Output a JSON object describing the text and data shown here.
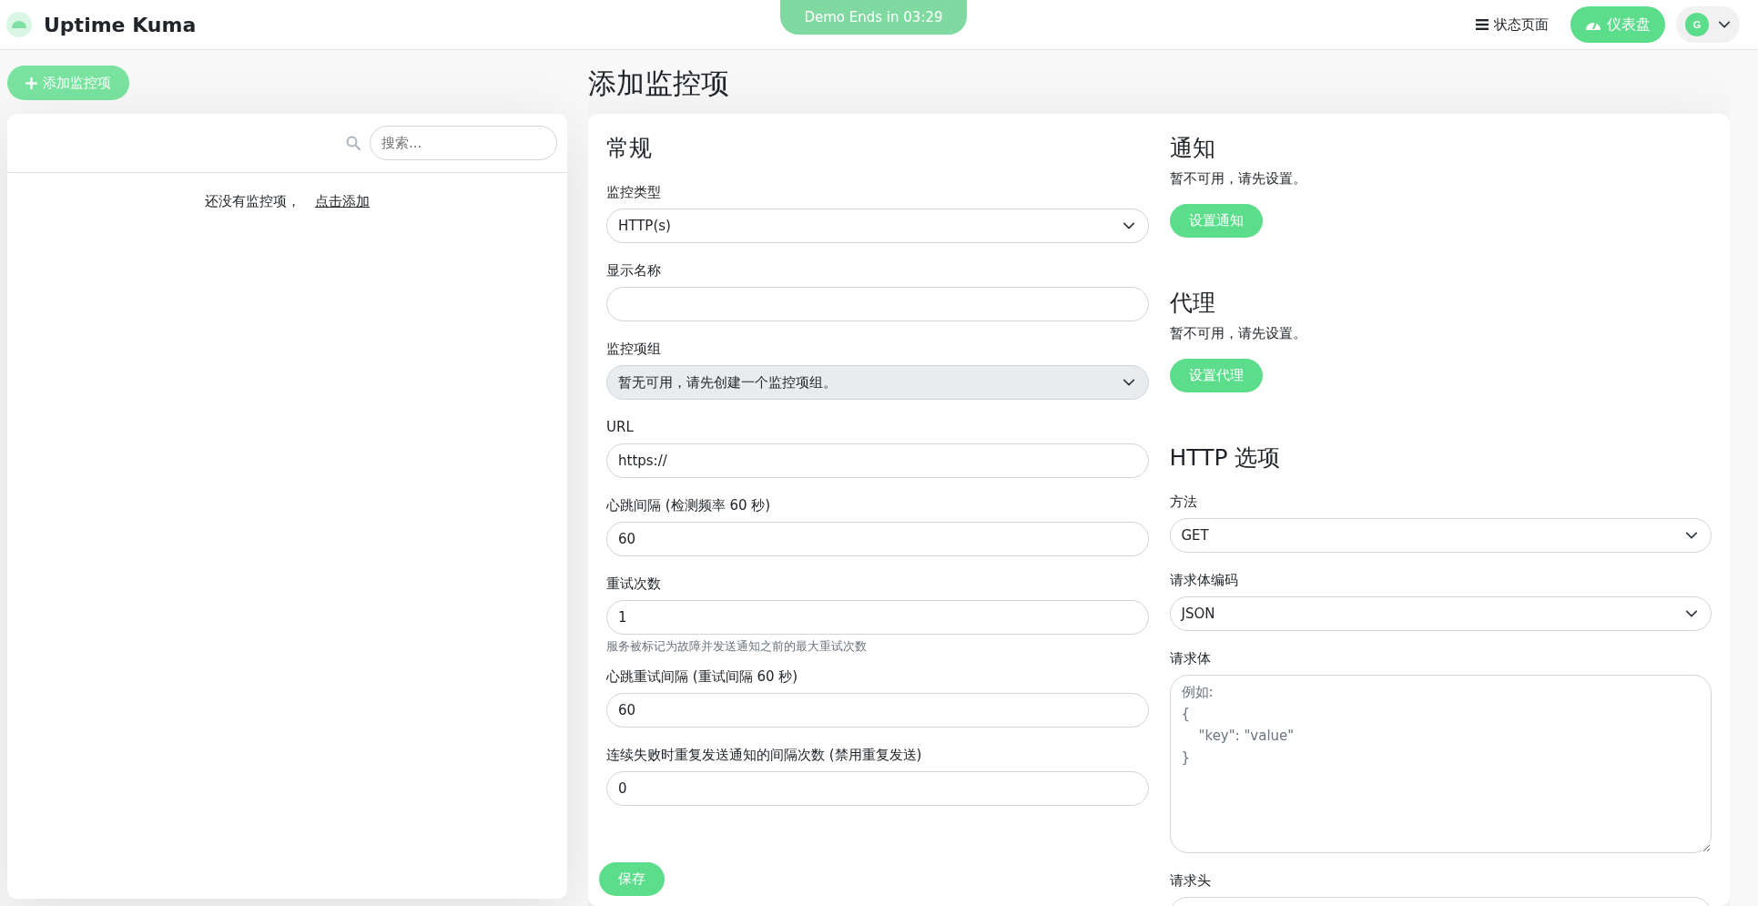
{
  "header": {
    "app_name": "Uptime Kuma",
    "demo_banner": "Demo Ends in 03:29",
    "nav_link": "状态页面",
    "dashboard_button": "仪表盘",
    "avatar_initial": "G"
  },
  "sidebar": {
    "add_button": "添加监控项",
    "search": {
      "placeholder": "搜索..."
    },
    "empty_text": "还没有监控项，",
    "empty_link": "点击添加"
  },
  "page_title": "添加监控项",
  "general": {
    "heading": "常规",
    "fields": [
      {
        "kind": "select",
        "label": "监控类型",
        "value": "HTTP(s)",
        "disabled": false
      },
      {
        "kind": "input",
        "label": "显示名称",
        "disabled": false
      },
      {
        "kind": "select",
        "label": "监控项组",
        "value": "暂无可用，请先创建一个监控项组。",
        "disabled": true
      },
      {
        "kind": "input",
        "label": "URL",
        "value": "https://",
        "disabled": false
      },
      {
        "kind": "input",
        "label": "心跳间隔 (检测频率 60 秒)",
        "value": "60",
        "disabled": false
      },
      {
        "kind": "input",
        "label": "重试次数",
        "value": "1",
        "help": "服务被标记为故障并发送通知之前的最大重试次数",
        "disabled": false
      },
      {
        "kind": "input",
        "label": "心跳重试间隔 (重试间隔 60 秒)",
        "value": "60",
        "disabled": false
      },
      {
        "kind": "input",
        "label": "连续失败时重复发送通知的间隔次数 (禁用重复发送)",
        "value": "0",
        "disabled": false
      }
    ]
  },
  "notifications": {
    "heading": "通知",
    "text": "暂不可用，请先设置。",
    "button": "设置通知"
  },
  "proxy": {
    "heading": "代理",
    "text": "暂不可用，请先设置。",
    "button": "设置代理"
  },
  "http_options": {
    "heading": "HTTP 选项",
    "fields": [
      {
        "kind": "select",
        "label": "方法",
        "value": "GET",
        "disabled": false
      },
      {
        "kind": "select",
        "label": "请求体编码",
        "value": "JSON",
        "disabled": false
      },
      {
        "kind": "textarea",
        "label": "请求体",
        "placeholder": "例如:\n{\n    \"key\": \"value\"\n}",
        "disabled": false
      },
      {
        "kind": "input",
        "label": "请求头"
      }
    ]
  },
  "save_button": "保存"
}
